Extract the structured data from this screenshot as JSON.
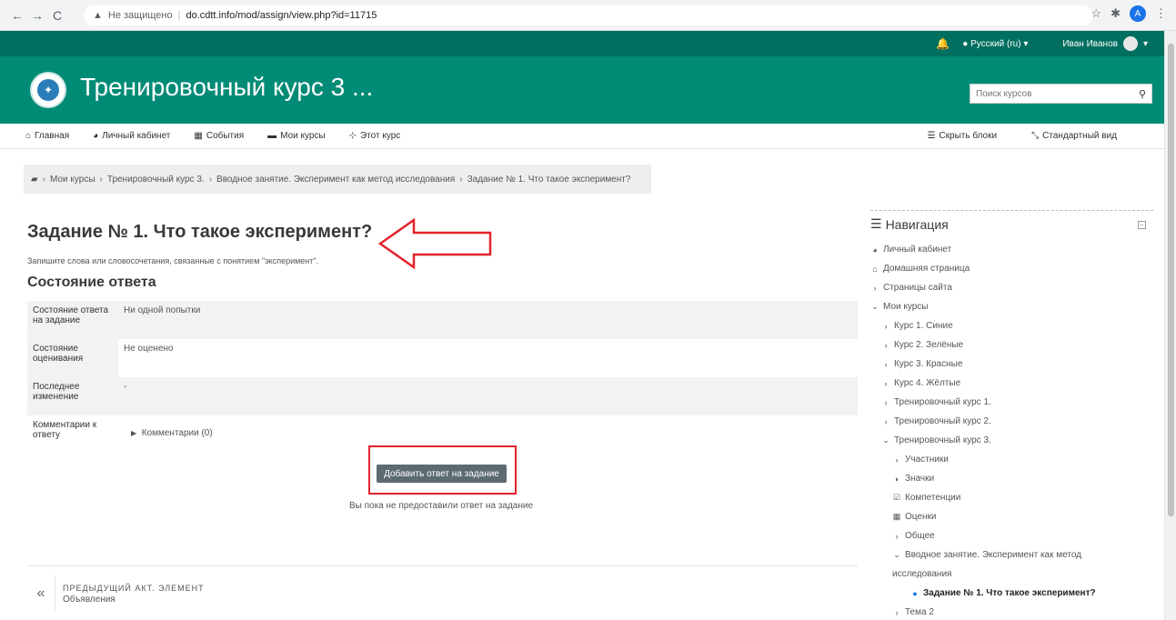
{
  "browser": {
    "security": "Не защищено",
    "url": "do.cdtt.info/mod/assign/view.php?id=11715",
    "profile_initial": "A"
  },
  "topnav": {
    "language": "Русский (ru)",
    "user_name": "Иван Иванов"
  },
  "header": {
    "site_title": "Тренировочный курс 3 ...",
    "search_placeholder": "Поиск курсов"
  },
  "menu": {
    "items": [
      "Главная",
      "Личный кабинет",
      "События",
      "Мои курсы",
      "Этот курс"
    ],
    "hide_blocks": "Скрыть блоки",
    "standard_view": "Стандартный вид"
  },
  "breadcrumb": [
    "Мои курсы",
    "Тренировочный курс 3.",
    "Вводное занятие. Эксперимент как метод исследования",
    "Задание № 1. Что такое эксперимент?"
  ],
  "main": {
    "title": "Задание № 1. Что такое эксперимент?",
    "intro": "Запишите слова или словосочетания, связанные с понятием \"эксперимент\".",
    "section_title": "Состояние ответа",
    "status_rows": [
      {
        "label": "Состояние ответа на задание",
        "value": "Ни одной попытки"
      },
      {
        "label": "Состояние оценивания",
        "value": "Не оценено"
      },
      {
        "label": "Последнее изменение",
        "value": "-"
      },
      {
        "label": "Комментарии к ответу",
        "value": "Комментарии (0)"
      }
    ],
    "add_button": "Добавить ответ на задание",
    "note": "Вы пока не предоставили ответ на задание"
  },
  "prev_activity": {
    "label": "ПРЕДЫДУЩИЙ АКТ. ЭЛЕМЕНТ",
    "name": "Объявления"
  },
  "navigation": {
    "title": "Навигация",
    "items": [
      "Личный кабинет",
      "Домашняя страница",
      "Страницы сайта",
      "Мои курсы",
      "Курс 1. Синие",
      "Курс 2. Зелёные",
      "Курс 3. Красные",
      "Курс 4. Жёлтые",
      "Тренировочный курс 1.",
      "Тренировочный курс 2.",
      "Тренировочный курс 3.",
      "Участники",
      "Значки",
      "Компетенции",
      "Оценки",
      "Общее",
      "Вводное занятие. Эксперимент как метод",
      "исследования",
      "Задание № 1. Что такое эксперимент?",
      "Тема 2"
    ]
  },
  "colors": {
    "topnav": "#006f5f",
    "header": "#008b76",
    "button": "#5c6a72",
    "annotation": "#e2232a"
  }
}
